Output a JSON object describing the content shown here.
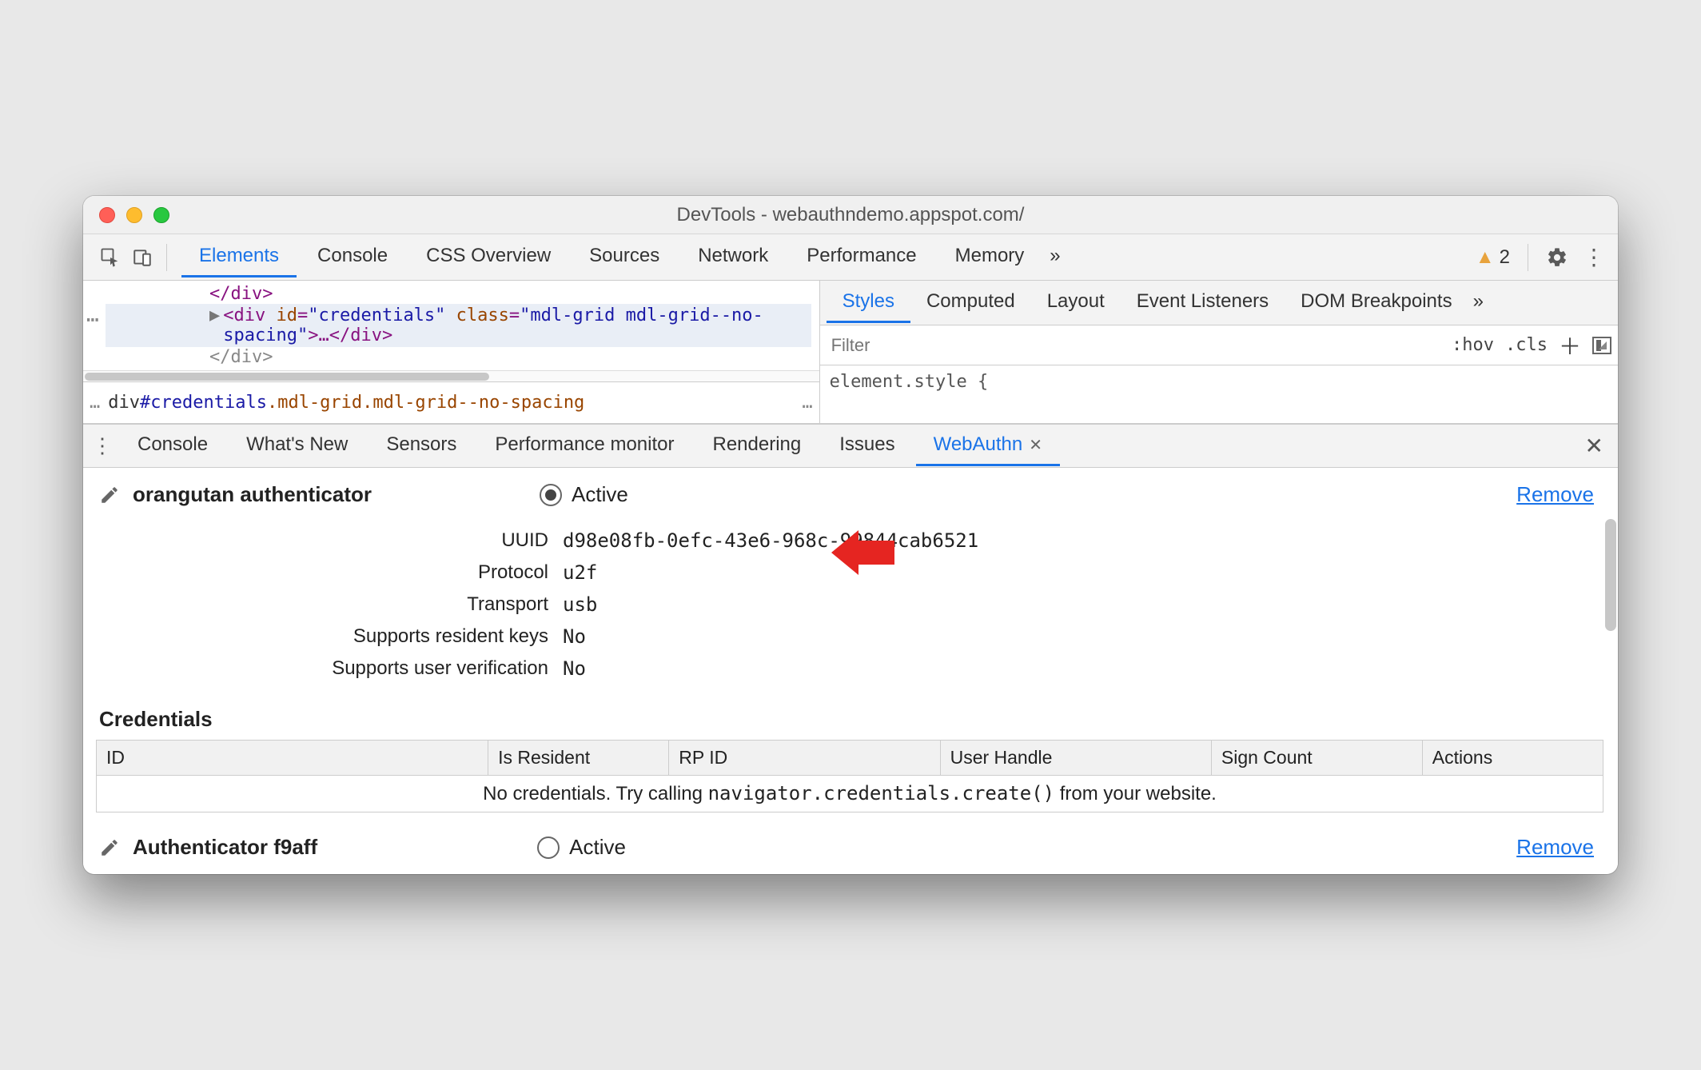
{
  "window": {
    "title": "DevTools - webauthndemo.appspot.com/"
  },
  "main_tabs": {
    "items": [
      "Elements",
      "Console",
      "CSS Overview",
      "Sources",
      "Network",
      "Performance",
      "Memory"
    ],
    "active_index": 0,
    "overflow": "»",
    "warnings_count": "2"
  },
  "dom": {
    "line1": "</div>",
    "line2_prefix": "▶",
    "line2_open": "<div ",
    "line2_attr_id_name": "id",
    "line2_attr_id_val": "\"credentials\"",
    "line2_attr_class_name": "class",
    "line2_attr_class_val": "\"mdl-grid mdl-grid--no-spacing\"",
    "line2_mid": ">…",
    "line2_close": "</div>",
    "line3": "</div>",
    "ellipsis_left": "⋯",
    "breadcrumb_left": "…",
    "breadcrumb_main_tag": "div",
    "breadcrumb_main_id": "#credentials",
    "breadcrumb_main_cls": ".mdl-grid.mdl-grid--no-spacing",
    "breadcrumb_right": "…"
  },
  "styles": {
    "tabs": [
      "Styles",
      "Computed",
      "Layout",
      "Event Listeners",
      "DOM Breakpoints"
    ],
    "active_index": 0,
    "overflow": "»",
    "filter_placeholder": "Filter",
    "hov": ":hov",
    "cls": ".cls",
    "rule": "element.style {"
  },
  "drawer": {
    "tabs": [
      "Console",
      "What's New",
      "Sensors",
      "Performance monitor",
      "Rendering",
      "Issues",
      "WebAuthn"
    ],
    "active_index": 6
  },
  "auth1": {
    "name": "orangutan authenticator",
    "active_label": "Active",
    "remove": "Remove",
    "uuid_label": "UUID",
    "uuid": "d98e08fb-0efc-43e6-968c-99844cab6521",
    "protocol_label": "Protocol",
    "protocol": "u2f",
    "transport_label": "Transport",
    "transport": "usb",
    "resident_label": "Supports resident keys",
    "resident": "No",
    "uv_label": "Supports user verification",
    "uv": "No"
  },
  "credentials": {
    "heading": "Credentials",
    "cols": [
      "ID",
      "Is Resident",
      "RP ID",
      "User Handle",
      "Sign Count",
      "Actions"
    ],
    "empty_pre": "No credentials. Try calling ",
    "empty_code": "navigator.credentials.create()",
    "empty_post": " from your website."
  },
  "auth2": {
    "name": "Authenticator f9aff",
    "active_label": "Active",
    "remove": "Remove"
  }
}
